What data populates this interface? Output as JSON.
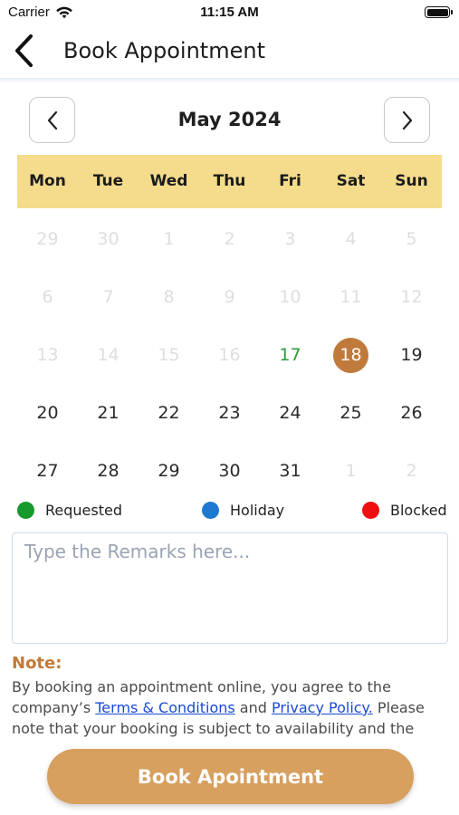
{
  "status_bar": {
    "carrier": "Carrier",
    "time": "11:15 AM"
  },
  "header": {
    "title": "Book Appointment"
  },
  "calendar": {
    "month_label": "May 2024",
    "weekdays": [
      "Mon",
      "Tue",
      "Wed",
      "Thu",
      "Fri",
      "Sat",
      "Sun"
    ],
    "days": [
      {
        "label": "29",
        "state": "faded"
      },
      {
        "label": "30",
        "state": "faded"
      },
      {
        "label": "1",
        "state": "faded"
      },
      {
        "label": "2",
        "state": "faded"
      },
      {
        "label": "3",
        "state": "faded"
      },
      {
        "label": "4",
        "state": "faded"
      },
      {
        "label": "5",
        "state": "faded"
      },
      {
        "label": "6",
        "state": "faded"
      },
      {
        "label": "7",
        "state": "faded"
      },
      {
        "label": "8",
        "state": "faded"
      },
      {
        "label": "9",
        "state": "faded"
      },
      {
        "label": "10",
        "state": "faded"
      },
      {
        "label": "11",
        "state": "faded"
      },
      {
        "label": "12",
        "state": "faded"
      },
      {
        "label": "13",
        "state": "faded"
      },
      {
        "label": "14",
        "state": "faded"
      },
      {
        "label": "15",
        "state": "faded"
      },
      {
        "label": "16",
        "state": "faded"
      },
      {
        "label": "17",
        "state": "requested"
      },
      {
        "label": "18",
        "state": "selected"
      },
      {
        "label": "19",
        "state": "normal"
      },
      {
        "label": "20",
        "state": "normal"
      },
      {
        "label": "21",
        "state": "normal"
      },
      {
        "label": "22",
        "state": "normal"
      },
      {
        "label": "23",
        "state": "normal"
      },
      {
        "label": "24",
        "state": "normal"
      },
      {
        "label": "25",
        "state": "normal"
      },
      {
        "label": "26",
        "state": "normal"
      },
      {
        "label": "27",
        "state": "normal"
      },
      {
        "label": "28",
        "state": "normal"
      },
      {
        "label": "29",
        "state": "normal"
      },
      {
        "label": "30",
        "state": "normal"
      },
      {
        "label": "31",
        "state": "normal"
      },
      {
        "label": "1",
        "state": "faded"
      },
      {
        "label": "2",
        "state": "faded"
      }
    ]
  },
  "legend": [
    {
      "label": "Requested",
      "color": "#159a2b"
    },
    {
      "label": "Holiday",
      "color": "#1e7ad0"
    },
    {
      "label": "Blocked",
      "color": "#ee1010"
    }
  ],
  "remarks": {
    "placeholder": "Type the Remarks here...",
    "value": ""
  },
  "note": {
    "label": "Note:",
    "text_1": "By booking an appointment online, you agree to the company’s ",
    "terms_link": "Terms & Conditions",
    "text_2": " and ",
    "privacy_link": "Privacy Policy.",
    "text_3": " Please note that your booking is subject to availability and the"
  },
  "book_button": {
    "label": "Book Apointment"
  },
  "colors": {
    "accent": "#d7a05f",
    "selected_day": "#c07a3b",
    "weekday_header": "#f4dc8c",
    "note_label": "#c27a35"
  }
}
